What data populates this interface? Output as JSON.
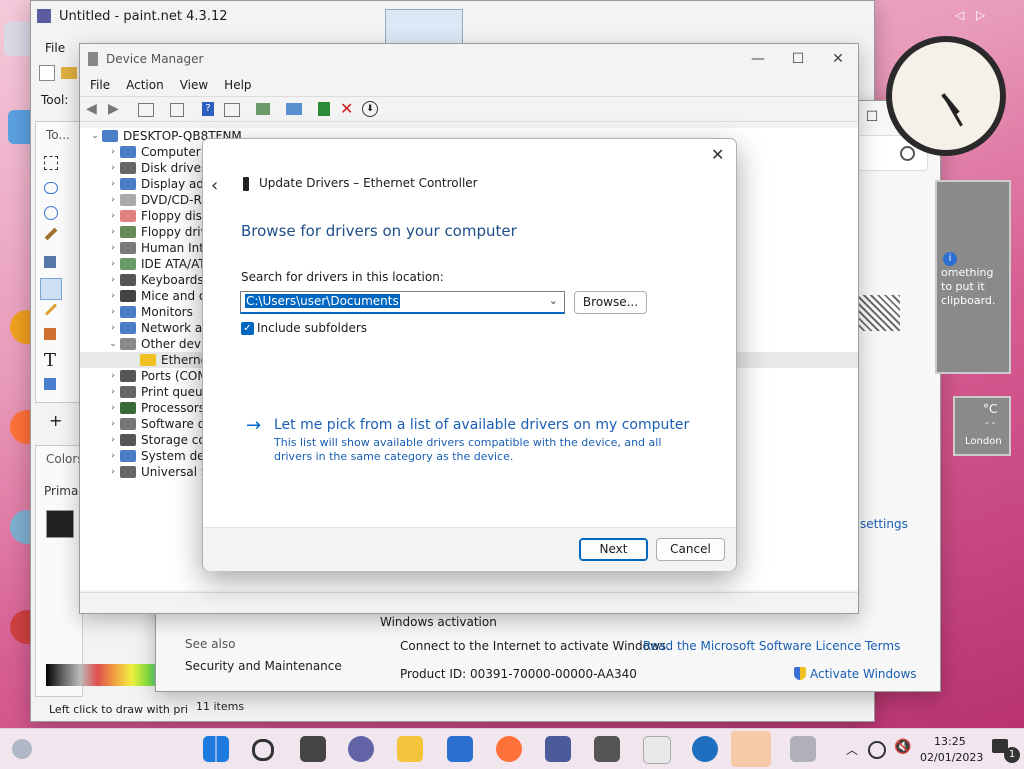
{
  "paintnet": {
    "title": "Untitled - paint.net 4.3.12",
    "menu_file": "File",
    "tool_label": "Tool:",
    "tools_header": "To...",
    "colors_label": "Colors",
    "primary_label": "Prima",
    "status_text": "Left click to draw with pri"
  },
  "device_manager": {
    "title": "Device Manager",
    "menu": [
      "File",
      "Action",
      "View",
      "Help"
    ],
    "root": "DESKTOP-QB8TFNM",
    "tree": [
      {
        "label": "Computer",
        "expanded": false
      },
      {
        "label": "Disk drives",
        "expanded": false
      },
      {
        "label": "Display ada",
        "expanded": false
      },
      {
        "label": "DVD/CD-RO",
        "expanded": false
      },
      {
        "label": "Floppy disk",
        "expanded": false
      },
      {
        "label": "Floppy driv",
        "expanded": false
      },
      {
        "label": "Human Inte",
        "expanded": false
      },
      {
        "label": "IDE ATA/ATA",
        "expanded": false
      },
      {
        "label": "Keyboards",
        "expanded": false
      },
      {
        "label": "Mice and ot",
        "expanded": false
      },
      {
        "label": "Monitors",
        "expanded": false
      },
      {
        "label": "Network ad",
        "expanded": false
      },
      {
        "label": "Other devic",
        "expanded": true
      },
      {
        "label": "Etherne",
        "child": true
      },
      {
        "label": "Ports (COM",
        "expanded": false
      },
      {
        "label": "Print queue",
        "expanded": false
      },
      {
        "label": "Processors",
        "expanded": false
      },
      {
        "label": "Software de",
        "expanded": false
      },
      {
        "label": "Storage cor",
        "expanded": false
      },
      {
        "label": "System dev",
        "expanded": false
      },
      {
        "label": "Universal S",
        "expanded": false
      }
    ]
  },
  "dialog": {
    "header": "Update Drivers – Ethernet Controller",
    "heading": "Browse for drivers on your computer",
    "search_label": "Search for drivers in this location:",
    "path_value": "C:\\Users\\user\\Documents",
    "browse_label": "Browse...",
    "include_subfolders": "Include subfolders",
    "include_checked": true,
    "pick_title": "Let me pick from a list of available drivers on my computer",
    "pick_desc_1": "This list will show available drivers compatible with the device, and all",
    "pick_desc_2": "drivers in the same category as the device.",
    "next_label": "Next",
    "cancel_label": "Cancel"
  },
  "settings_window": {
    "activation_header": "Windows activation",
    "see_also": "See also",
    "security_link": "Security and Maintenance",
    "connect_text": "Connect to the Internet to activate Windows.",
    "licence_link": "Read the Microsoft Software Licence Terms",
    "product_id": "Product ID:  00391-70000-00000-AA340",
    "activate_link": "Activate Windows",
    "settings_link": "settings",
    "items_count": "11 items"
  },
  "gadgets": {
    "clipboard_text_1": "omething",
    "clipboard_text_2": "to put it",
    "clipboard_text_3": "clipboard.",
    "weather_unit": "°C",
    "weather_dash": "- -",
    "weather_city": "London"
  },
  "taskbar": {
    "time": "13:25",
    "date": "02/01/2023",
    "notification_count": "1"
  },
  "colors": {
    "accent": "#0067c0",
    "link": "#1a5fb4",
    "taskbar_bg": "#f1e6ee"
  }
}
